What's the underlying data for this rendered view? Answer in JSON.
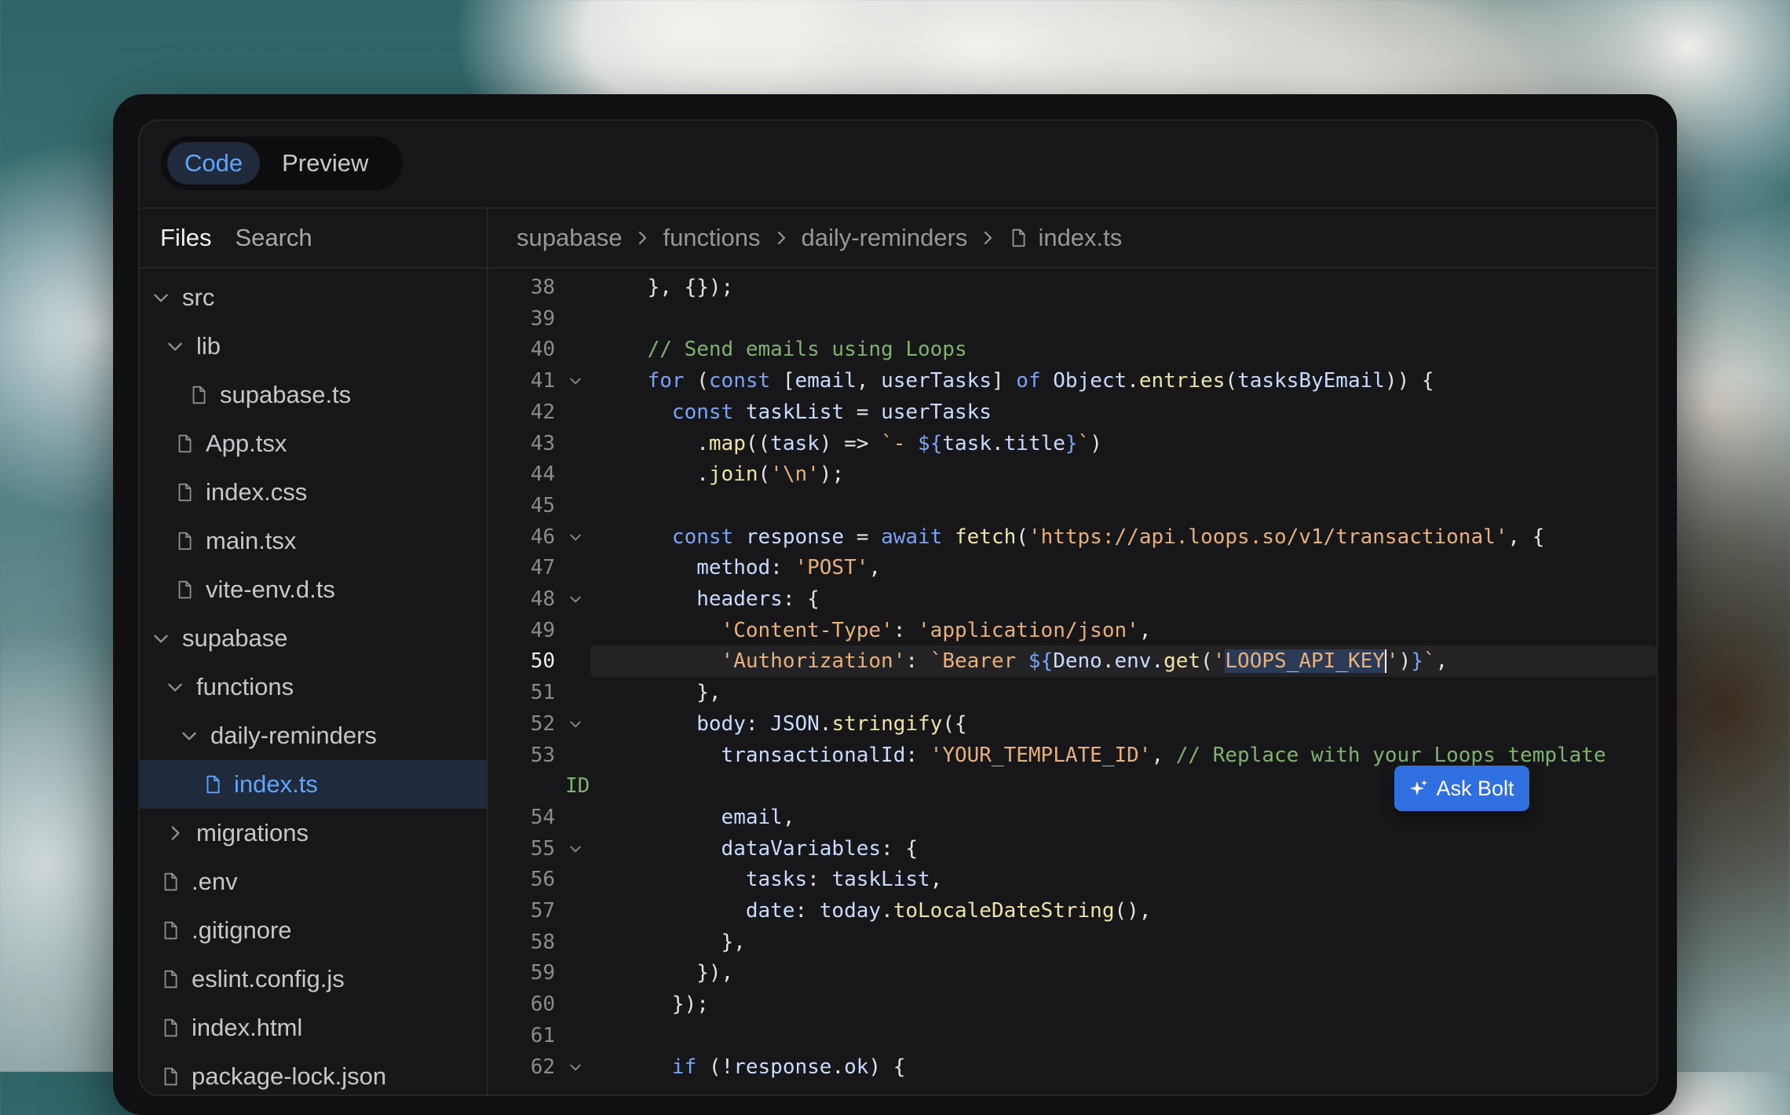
{
  "view_toggle": {
    "code_label": "Code",
    "preview_label": "Preview",
    "active": "Code"
  },
  "sidebar": {
    "tabs": {
      "files_label": "Files",
      "search_label": "Search",
      "active": "Files"
    },
    "tree": [
      {
        "name": "src",
        "type": "folder",
        "expanded": true,
        "depth": 0
      },
      {
        "name": "lib",
        "type": "folder",
        "expanded": true,
        "depth": 1
      },
      {
        "name": "supabase.ts",
        "type": "file",
        "depth": 2
      },
      {
        "name": "App.tsx",
        "type": "file",
        "depth": 1
      },
      {
        "name": "index.css",
        "type": "file",
        "depth": 1
      },
      {
        "name": "main.tsx",
        "type": "file",
        "depth": 1
      },
      {
        "name": "vite-env.d.ts",
        "type": "file",
        "depth": 1
      },
      {
        "name": "supabase",
        "type": "folder",
        "expanded": true,
        "depth": 0
      },
      {
        "name": "functions",
        "type": "folder",
        "expanded": true,
        "depth": 1
      },
      {
        "name": "daily-reminders",
        "type": "folder",
        "expanded": true,
        "depth": 2
      },
      {
        "name": "index.ts",
        "type": "file",
        "depth": 3,
        "selected": true
      },
      {
        "name": "migrations",
        "type": "folder",
        "expanded": false,
        "depth": 1
      },
      {
        "name": ".env",
        "type": "file",
        "depth": 0
      },
      {
        "name": ".gitignore",
        "type": "file",
        "depth": 0
      },
      {
        "name": "eslint.config.js",
        "type": "file",
        "depth": 0
      },
      {
        "name": "index.html",
        "type": "file",
        "depth": 0
      },
      {
        "name": "package-lock.json",
        "type": "file",
        "depth": 0
      }
    ]
  },
  "breadcrumb": [
    "supabase",
    "functions",
    "daily-reminders",
    "index.ts"
  ],
  "editor": {
    "current_line": 50,
    "lines": [
      {
        "n": "38",
        "fold": false,
        "tokens": [
          [
            "p",
            "    }, {});"
          ]
        ]
      },
      {
        "n": "39",
        "fold": false,
        "tokens": []
      },
      {
        "n": "40",
        "fold": false,
        "tokens": [
          [
            "p",
            "    "
          ],
          [
            "c",
            "// Send emails using Loops"
          ]
        ]
      },
      {
        "n": "41",
        "fold": true,
        "tokens": [
          [
            "p",
            "    "
          ],
          [
            "k",
            "for"
          ],
          [
            "p",
            " ("
          ],
          [
            "k",
            "const"
          ],
          [
            "p",
            " ["
          ],
          [
            "v",
            "email"
          ],
          [
            "p",
            ", "
          ],
          [
            "v",
            "userTasks"
          ],
          [
            "p",
            "] "
          ],
          [
            "k",
            "of"
          ],
          [
            "p",
            " "
          ],
          [
            "v",
            "Object"
          ],
          [
            "p",
            "."
          ],
          [
            "f",
            "entries"
          ],
          [
            "p",
            "("
          ],
          [
            "v",
            "tasksByEmail"
          ],
          [
            "p",
            ")) {"
          ]
        ]
      },
      {
        "n": "42",
        "fold": false,
        "tokens": [
          [
            "p",
            "      "
          ],
          [
            "k",
            "const"
          ],
          [
            "p",
            " "
          ],
          [
            "v",
            "taskList"
          ],
          [
            "p",
            " = "
          ],
          [
            "v",
            "userTasks"
          ]
        ]
      },
      {
        "n": "43",
        "fold": false,
        "tokens": [
          [
            "p",
            "        ."
          ],
          [
            "f",
            "map"
          ],
          [
            "p",
            "(("
          ],
          [
            "v",
            "task"
          ],
          [
            "p",
            ") => "
          ],
          [
            "s",
            "`- "
          ],
          [
            "k",
            "${"
          ],
          [
            "v",
            "task"
          ],
          [
            "p",
            "."
          ],
          [
            "v",
            "title"
          ],
          [
            "k",
            "}"
          ],
          [
            "s",
            "`"
          ],
          [
            "p",
            ")"
          ]
        ]
      },
      {
        "n": "44",
        "fold": false,
        "tokens": [
          [
            "p",
            "        ."
          ],
          [
            "f",
            "join"
          ],
          [
            "p",
            "("
          ],
          [
            "s",
            "'\\n'"
          ],
          [
            "p",
            ");"
          ]
        ]
      },
      {
        "n": "45",
        "fold": false,
        "tokens": []
      },
      {
        "n": "46",
        "fold": true,
        "tokens": [
          [
            "p",
            "      "
          ],
          [
            "k",
            "const"
          ],
          [
            "p",
            " "
          ],
          [
            "v",
            "response"
          ],
          [
            "p",
            " = "
          ],
          [
            "k",
            "await"
          ],
          [
            "p",
            " "
          ],
          [
            "f",
            "fetch"
          ],
          [
            "p",
            "("
          ],
          [
            "s",
            "'https://api.loops.so/v1/transactional'"
          ],
          [
            "p",
            ", {"
          ]
        ]
      },
      {
        "n": "47",
        "fold": false,
        "tokens": [
          [
            "p",
            "        "
          ],
          [
            "v",
            "method"
          ],
          [
            "p",
            ": "
          ],
          [
            "s",
            "'POST'"
          ],
          [
            "p",
            ","
          ]
        ]
      },
      {
        "n": "48",
        "fold": true,
        "tokens": [
          [
            "p",
            "        "
          ],
          [
            "v",
            "headers"
          ],
          [
            "p",
            ": {"
          ]
        ]
      },
      {
        "n": "49",
        "fold": false,
        "tokens": [
          [
            "p",
            "          "
          ],
          [
            "s",
            "'Content-Type'"
          ],
          [
            "p",
            ": "
          ],
          [
            "s",
            "'application/json'"
          ],
          [
            "p",
            ","
          ]
        ]
      },
      {
        "n": "50",
        "fold": false,
        "tokens": [
          [
            "p",
            "          "
          ],
          [
            "s",
            "'Authorization'"
          ],
          [
            "p",
            ": "
          ],
          [
            "s",
            "`Bearer "
          ],
          [
            "k",
            "${"
          ],
          [
            "v",
            "Deno"
          ],
          [
            "p",
            "."
          ],
          [
            "v",
            "env"
          ],
          [
            "p",
            "."
          ],
          [
            "f",
            "get"
          ],
          [
            "p",
            "("
          ],
          [
            "s",
            "'"
          ],
          [
            "sel",
            "LOOPS_API_KEY"
          ],
          [
            "s",
            "'"
          ],
          [
            "p",
            ")"
          ],
          [
            "k",
            "}"
          ],
          [
            "s",
            "`"
          ],
          [
            "p",
            ","
          ]
        ]
      },
      {
        "n": "51",
        "fold": false,
        "tokens": [
          [
            "p",
            "        },"
          ]
        ]
      },
      {
        "n": "52",
        "fold": true,
        "tokens": [
          [
            "p",
            "        "
          ],
          [
            "v",
            "body"
          ],
          [
            "p",
            ": "
          ],
          [
            "v",
            "JSON"
          ],
          [
            "p",
            "."
          ],
          [
            "f",
            "stringify"
          ],
          [
            "p",
            "({"
          ]
        ]
      },
      {
        "n": "53",
        "fold": false,
        "tokens": [
          [
            "p",
            "          "
          ],
          [
            "v",
            "transactionalId"
          ],
          [
            "p",
            ": "
          ],
          [
            "s",
            "'YOUR_TEMPLATE_ID'"
          ],
          [
            "p",
            ", "
          ],
          [
            "c",
            "// Replace with your Loops template"
          ]
        ]
      },
      {
        "n": "",
        "fold": false,
        "tokens": [
          [
            "c",
            "ID"
          ]
        ],
        "wrap": true
      },
      {
        "n": "54",
        "fold": false,
        "tokens": [
          [
            "p",
            "          "
          ],
          [
            "v",
            "email"
          ],
          [
            "p",
            ","
          ]
        ]
      },
      {
        "n": "55",
        "fold": true,
        "tokens": [
          [
            "p",
            "          "
          ],
          [
            "v",
            "dataVariables"
          ],
          [
            "p",
            ": {"
          ]
        ]
      },
      {
        "n": "56",
        "fold": false,
        "tokens": [
          [
            "p",
            "            "
          ],
          [
            "v",
            "tasks"
          ],
          [
            "p",
            ": "
          ],
          [
            "v",
            "taskList"
          ],
          [
            "p",
            ","
          ]
        ]
      },
      {
        "n": "57",
        "fold": false,
        "tokens": [
          [
            "p",
            "            "
          ],
          [
            "v",
            "date"
          ],
          [
            "p",
            ": "
          ],
          [
            "v",
            "today"
          ],
          [
            "p",
            "."
          ],
          [
            "f",
            "toLocaleDateString"
          ],
          [
            "p",
            "(),"
          ]
        ]
      },
      {
        "n": "58",
        "fold": false,
        "tokens": [
          [
            "p",
            "          },"
          ]
        ]
      },
      {
        "n": "59",
        "fold": false,
        "tokens": [
          [
            "p",
            "        }),"
          ]
        ]
      },
      {
        "n": "60",
        "fold": false,
        "tokens": [
          [
            "p",
            "      });"
          ]
        ]
      },
      {
        "n": "61",
        "fold": false,
        "tokens": []
      },
      {
        "n": "62",
        "fold": true,
        "tokens": [
          [
            "p",
            "      "
          ],
          [
            "k",
            "if"
          ],
          [
            "p",
            " (!"
          ],
          [
            "v",
            "response"
          ],
          [
            "p",
            "."
          ],
          [
            "v",
            "ok"
          ],
          [
            "p",
            ") {"
          ]
        ]
      }
    ]
  },
  "ask_bolt": {
    "label": "Ask Bolt",
    "icon": "sparkle-icon"
  },
  "colors": {
    "accent": "#60a5fa",
    "button": "#2f6fe0",
    "panel": "#171719"
  }
}
